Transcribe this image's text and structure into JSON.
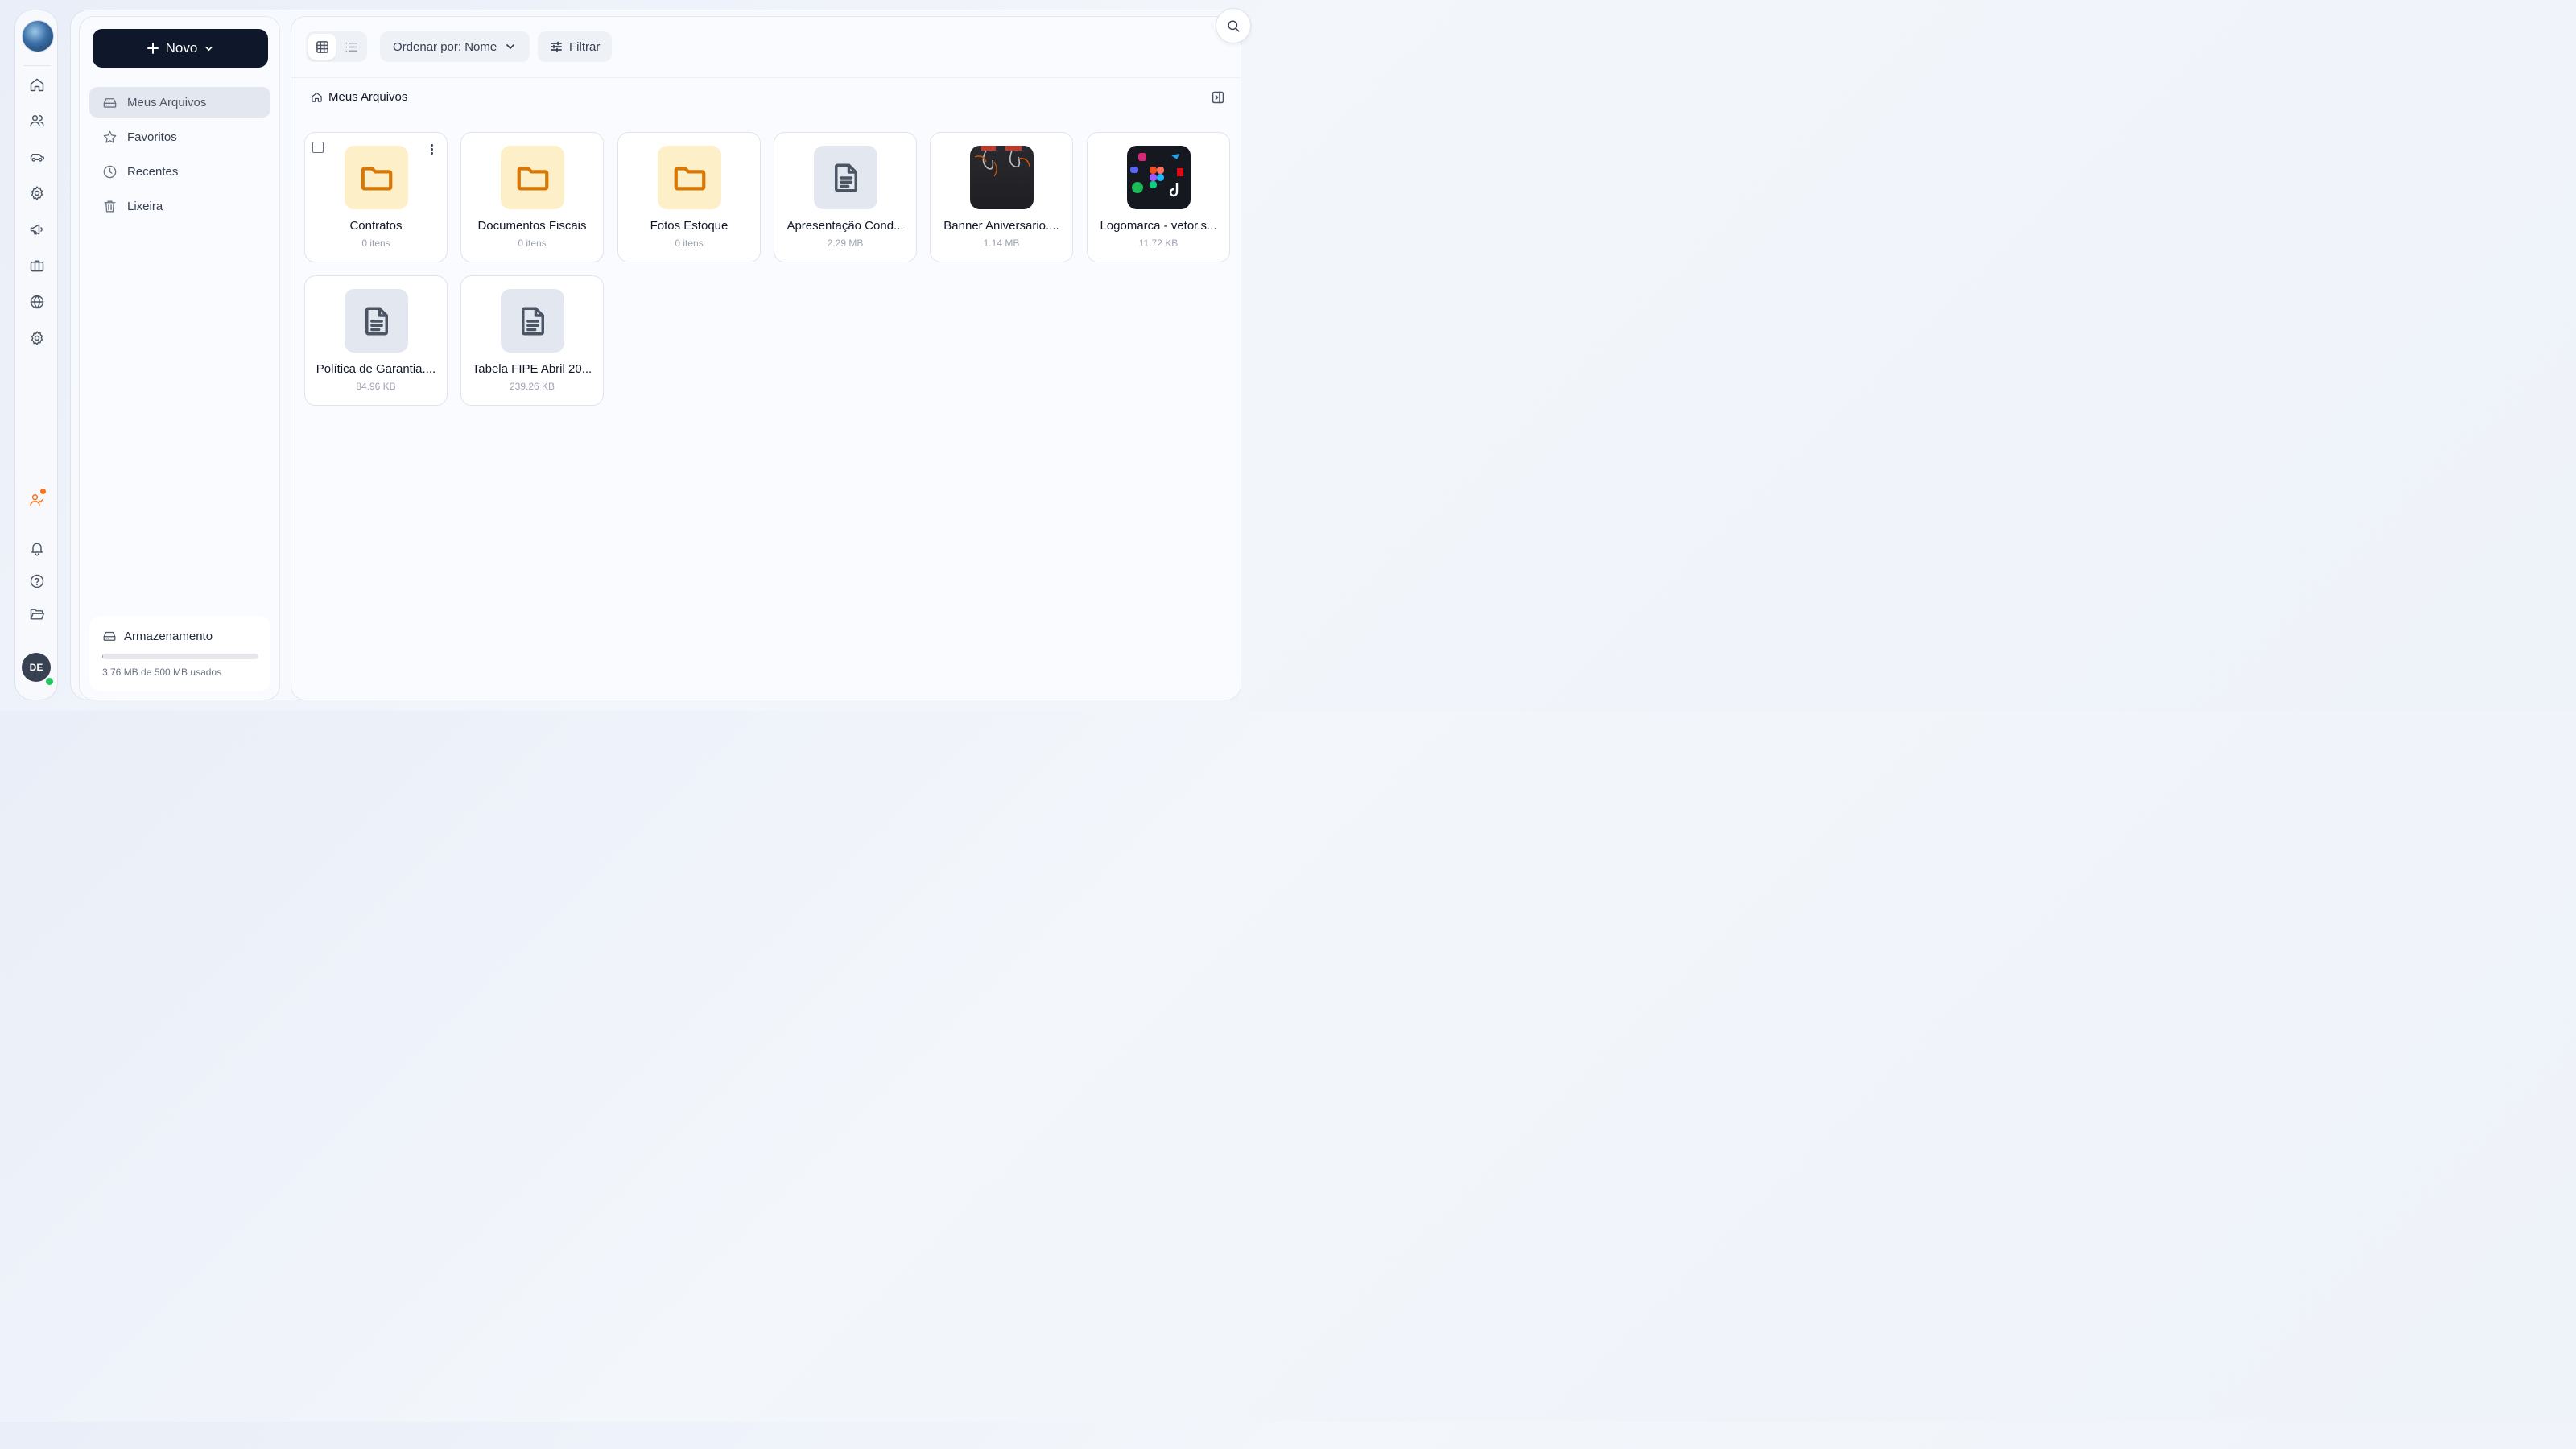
{
  "user": {
    "initials": "DE"
  },
  "rail": {
    "items": [
      {
        "icon": "home-icon"
      },
      {
        "icon": "users-icon"
      },
      {
        "icon": "car-icon"
      },
      {
        "icon": "gear-icon"
      },
      {
        "icon": "megaphone-icon"
      },
      {
        "icon": "briefcase-icon"
      },
      {
        "icon": "globe-icon"
      },
      {
        "icon": "settings-icon"
      }
    ],
    "bottom": [
      {
        "icon": "user-activity-icon",
        "accent": "#f97316"
      },
      {
        "icon": "bell-icon"
      },
      {
        "icon": "help-icon"
      },
      {
        "icon": "folder-open-icon"
      }
    ]
  },
  "sidebar": {
    "new_label": "Novo",
    "items": [
      {
        "label": "Meus Arquivos",
        "icon": "drive-icon",
        "active": true
      },
      {
        "label": "Favoritos",
        "icon": "star-icon"
      },
      {
        "label": "Recentes",
        "icon": "clock-icon"
      },
      {
        "label": "Lixeira",
        "icon": "trash-icon"
      }
    ],
    "storage": {
      "title": "Armazenamento",
      "usage_text": "3.76 MB de 500 MB usados",
      "used_fraction": 0.0075
    }
  },
  "toolbar": {
    "view_mode": "grid",
    "sort_label": "Ordenar por: Nome",
    "filter_label": "Filtrar"
  },
  "breadcrumb": {
    "current": "Meus Arquivos"
  },
  "files": [
    {
      "name": "Contratos",
      "meta": "0 itens",
      "kind": "folder"
    },
    {
      "name": "Documentos Fiscais",
      "meta": "0 itens",
      "kind": "folder"
    },
    {
      "name": "Fotos Estoque",
      "meta": "0 itens",
      "kind": "folder"
    },
    {
      "name": "Apresentação Cond...",
      "meta": "2.29 MB",
      "kind": "document"
    },
    {
      "name": "Banner Aniversario....",
      "meta": "1.14 MB",
      "kind": "image"
    },
    {
      "name": "Logomarca - vetor.s...",
      "meta": "11.72 KB",
      "kind": "image"
    },
    {
      "name": "Política de Garantia....",
      "meta": "84.96 KB",
      "kind": "document"
    },
    {
      "name": "Tabela FIPE Abril 20...",
      "meta": "239.26 KB",
      "kind": "document"
    }
  ],
  "colors": {
    "primary_button": "#0f172a",
    "folder_bg": "#fdf0c8",
    "folder_icon": "#d97706",
    "online": "#22c55e",
    "notification": "#f97316"
  }
}
